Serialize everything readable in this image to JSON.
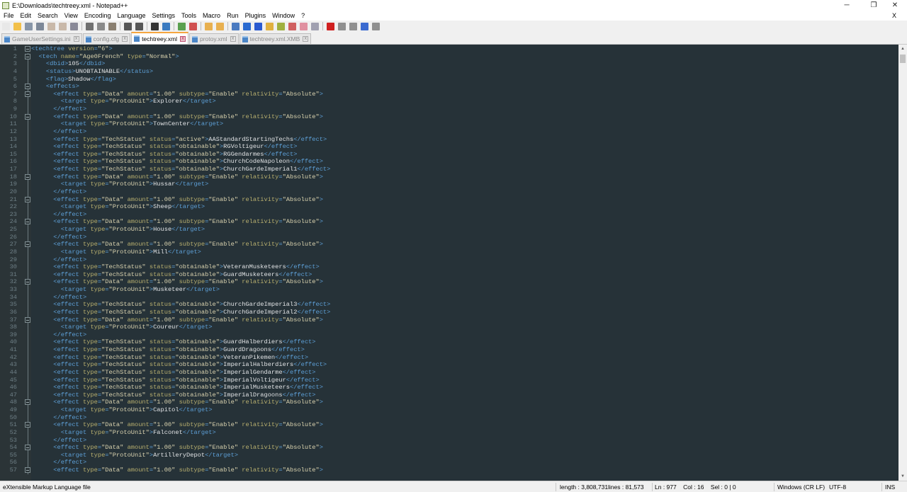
{
  "window": {
    "title": "E:\\Downloads\\techtreey.xml - Notepad++",
    "minimize": "─",
    "maximize": "❐",
    "close": "✕"
  },
  "menu": [
    "File",
    "Edit",
    "Search",
    "View",
    "Encoding",
    "Language",
    "Settings",
    "Tools",
    "Macro",
    "Run",
    "Plugins",
    "Window",
    "?"
  ],
  "menu_close": "X",
  "toolbar": [
    {
      "icon": "new-file-icon",
      "color": "#e8e8e8"
    },
    {
      "icon": "open-file-icon",
      "color": "#f2c04a"
    },
    {
      "icon": "save-icon",
      "color": "#8896a8"
    },
    {
      "icon": "save-all-icon",
      "color": "#7d8898"
    },
    {
      "icon": "close-icon",
      "color": "#c9b9a9"
    },
    {
      "icon": "close-all-icon",
      "color": "#c9b9a9"
    },
    {
      "icon": "print-icon",
      "color": "#8a8a98"
    },
    "sep",
    {
      "icon": "cut-icon",
      "color": "#707070"
    },
    {
      "icon": "copy-icon",
      "color": "#8a8a8a"
    },
    {
      "icon": "paste-icon",
      "color": "#8a7f70"
    },
    "sep",
    {
      "icon": "undo-icon",
      "color": "#555"
    },
    {
      "icon": "redo-icon",
      "color": "#555"
    },
    "sep",
    {
      "icon": "find-icon",
      "color": "#333"
    },
    {
      "icon": "replace-icon",
      "color": "#3a7ac0"
    },
    "sep",
    {
      "icon": "zoom-in-icon",
      "color": "#5aa050"
    },
    {
      "icon": "zoom-out-icon",
      "color": "#d05050"
    },
    "sep",
    {
      "icon": "sync-vertical-icon",
      "color": "#e8b050"
    },
    {
      "icon": "sync-horizontal-icon",
      "color": "#e8b050"
    },
    "sep",
    {
      "icon": "word-wrap-icon",
      "color": "#4a7ac0"
    },
    {
      "icon": "show-all-chars-icon",
      "color": "#2a6ad0"
    },
    {
      "icon": "indent-guide-icon",
      "color": "#2a5ad0"
    },
    {
      "icon": "doc-map-icon",
      "color": "#e0b040"
    },
    {
      "icon": "function-list-icon",
      "color": "#a0b040"
    },
    {
      "icon": "folder-workspace-icon",
      "color": "#d06060"
    },
    {
      "icon": "monitor-icon",
      "color": "#e090a0"
    },
    {
      "icon": "eye-icon",
      "color": "#a0a0b0"
    },
    "sep",
    {
      "icon": "record-macro-icon",
      "color": "#d02020"
    },
    {
      "icon": "stop-macro-icon",
      "color": "#909090"
    },
    {
      "icon": "play-macro-icon",
      "color": "#909090"
    },
    {
      "icon": "run-macro-multiple-icon",
      "color": "#3a6ad0"
    },
    {
      "icon": "save-macro-icon",
      "color": "#909090"
    }
  ],
  "tabs": [
    {
      "label": "GameUserSettings.ini",
      "active": false
    },
    {
      "label": "config.cfg",
      "active": false
    },
    {
      "label": "techtreey.xml",
      "active": true
    },
    {
      "label": "protoy.xml",
      "active": false
    },
    {
      "label": "techtreey.xml.XMB",
      "active": false
    }
  ],
  "tab_close": "x",
  "editor": {
    "first_line": 1,
    "lines": [
      "<techtree version=\"6\">",
      "  <tech name=\"Age0French\" type=\"Normal\">",
      "    <dbid>105</dbid>",
      "    <status>UNOBTAINABLE</status>",
      "    <flag>Shadow</flag>",
      "    <effects>",
      "      <effect type=\"Data\" amount=\"1.00\" subtype=\"Enable\" relativity=\"Absolute\">",
      "        <target type=\"ProtoUnit\">Explorer</target>",
      "      </effect>",
      "      <effect type=\"Data\" amount=\"1.00\" subtype=\"Enable\" relativity=\"Absolute\">",
      "        <target type=\"ProtoUnit\">TownCenter</target>",
      "      </effect>",
      "      <effect type=\"TechStatus\" status=\"active\">AAStandardStartingTechs</effect>",
      "      <effect type=\"TechStatus\" status=\"obtainable\">RGVoltigeur</effect>",
      "      <effect type=\"TechStatus\" status=\"obtainable\">RGGendarmes</effect>",
      "      <effect type=\"TechStatus\" status=\"obtainable\">ChurchCodeNapoleon</effect>",
      "      <effect type=\"TechStatus\" status=\"obtainable\">ChurchGardeImperial1</effect>",
      "      <effect type=\"Data\" amount=\"1.00\" subtype=\"Enable\" relativity=\"Absolute\">",
      "        <target type=\"ProtoUnit\">Hussar</target>",
      "      </effect>",
      "      <effect type=\"Data\" amount=\"1.00\" subtype=\"Enable\" relativity=\"Absolute\">",
      "        <target type=\"ProtoUnit\">Sheep</target>",
      "      </effect>",
      "      <effect type=\"Data\" amount=\"1.00\" subtype=\"Enable\" relativity=\"Absolute\">",
      "        <target type=\"ProtoUnit\">House</target>",
      "      </effect>",
      "      <effect type=\"Data\" amount=\"1.00\" subtype=\"Enable\" relativity=\"Absolute\">",
      "        <target type=\"ProtoUnit\">Mill</target>",
      "      </effect>",
      "      <effect type=\"TechStatus\" status=\"obtainable\">VeteranMusketeers</effect>",
      "      <effect type=\"TechStatus\" status=\"obtainable\">GuardMusketeers</effect>",
      "      <effect type=\"Data\" amount=\"1.00\" subtype=\"Enable\" relativity=\"Absolute\">",
      "        <target type=\"ProtoUnit\">Musketeer</target>",
      "      </effect>",
      "      <effect type=\"TechStatus\" status=\"obtainable\">ChurchGardeImperial3</effect>",
      "      <effect type=\"TechStatus\" status=\"obtainable\">ChurchGardeImperial2</effect>",
      "      <effect type=\"Data\" amount=\"1.00\" subtype=\"Enable\" relativity=\"Absolute\">",
      "        <target type=\"ProtoUnit\">Coureur</target>",
      "      </effect>",
      "      <effect type=\"TechStatus\" status=\"obtainable\">GuardHalberdiers</effect>",
      "      <effect type=\"TechStatus\" status=\"obtainable\">GuardDragoons</effect>",
      "      <effect type=\"TechStatus\" status=\"obtainable\">VeteranPikemen</effect>",
      "      <effect type=\"TechStatus\" status=\"obtainable\">ImperialHalberdiers</effect>",
      "      <effect type=\"TechStatus\" status=\"obtainable\">ImperialGendarme</effect>",
      "      <effect type=\"TechStatus\" status=\"obtainable\">ImperialVoltigeur</effect>",
      "      <effect type=\"TechStatus\" status=\"obtainable\">ImperialMusketeers</effect>",
      "      <effect type=\"TechStatus\" status=\"obtainable\">ImperialDragoons</effect>",
      "      <effect type=\"Data\" amount=\"1.00\" subtype=\"Enable\" relativity=\"Absolute\">",
      "        <target type=\"ProtoUnit\">Capitol</target>",
      "      </effect>",
      "      <effect type=\"Data\" amount=\"1.00\" subtype=\"Enable\" relativity=\"Absolute\">",
      "        <target type=\"ProtoUnit\">Falconet</target>",
      "      </effect>",
      "      <effect type=\"Data\" amount=\"1.00\" subtype=\"Enable\" relativity=\"Absolute\">",
      "        <target type=\"ProtoUnit\">ArtilleryDepot</target>",
      "      </effect>",
      "      <effect type=\"Data\" amount=\"1.00\" subtype=\"Enable\" relativity=\"Absolute\">"
    ]
  },
  "status": {
    "file_type": "eXtensible Markup Language file",
    "length": "length : 3,808,731",
    "lines": "lines : 81,573",
    "position": "Ln : 977    Col : 16    Sel : 0 | 0",
    "eol": "Windows (CR LF)",
    "encoding": "UTF-8",
    "mode": "INS"
  },
  "colors": {
    "editor_bg": "#263238",
    "tag": "#5d9fd6",
    "attr_name": "#b7ae6e",
    "attr_value": "#d9d2ae",
    "text": "#e0e2e4",
    "active_tab_accent": "#f5a640"
  }
}
